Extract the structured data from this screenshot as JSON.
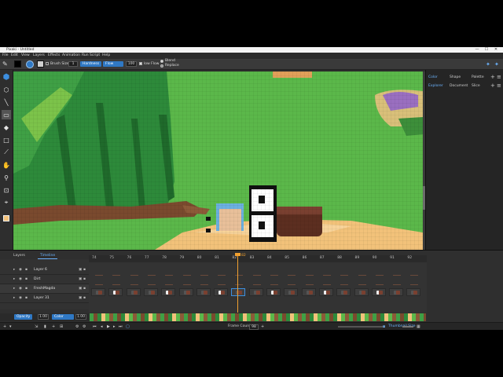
{
  "window": {
    "title": "Pixaki - Untitled",
    "controls": [
      "—",
      "☐",
      "✕"
    ]
  },
  "menu": [
    "File",
    "Edit",
    "View",
    "Layers",
    "Effects",
    "Animation",
    "Run Script",
    "Help"
  ],
  "tool_options": {
    "brush_size_label": "Brush Size",
    "brush_size_value": "1",
    "hardness_label": "Hardness",
    "flow_label": "Flow",
    "flow_value": "100",
    "low_flow_label": "low Flow",
    "blend_label": "Blend",
    "replace_label": "Replace"
  },
  "tools": [
    "hexagon-tool-icon",
    "lasso-icon",
    "line-icon",
    "rectangle-select-icon",
    "eraser-icon",
    "rectangle-icon",
    "eyedropper-icon",
    "hand-icon",
    "zoom-icon",
    "crop-icon",
    "transform-icon",
    "color-swap-icon"
  ],
  "right_panel": {
    "tabs_top": [
      "Color",
      "Shape",
      "Palette"
    ],
    "tabs_bottom": [
      "Explorer",
      "Document",
      "Slice"
    ]
  },
  "timeline": {
    "tabs": [
      "Layers",
      "Timeline"
    ],
    "frame_numbers": [
      "74",
      "75",
      "76",
      "77",
      "78",
      "79",
      "80",
      "81",
      "82",
      "83",
      "84",
      "85",
      "86",
      "87",
      "88",
      "89",
      "90",
      "91",
      "92"
    ],
    "playhead_label": "82",
    "layers": [
      {
        "name": "Layer 6"
      },
      {
        "name": "Dirt"
      },
      {
        "name": "FreshMagda"
      },
      {
        "name": "Layer 31"
      }
    ],
    "opacity_label": "Opacity",
    "opacity_value": "1.00",
    "color_label": "Color",
    "color_value": "1.00"
  },
  "bottom_bar": {
    "frame_count_label": "Frame Count",
    "frame_count_value": "98",
    "thumbnail_label": "Thumbnail Size"
  },
  "colors": {
    "accent": "#2f78c4",
    "grass": "#5bb84a",
    "dark_grass": "#2d8a3a",
    "path": "#f2c27a",
    "dirt": "#7a4a2e",
    "playhead": "#f0a030"
  }
}
